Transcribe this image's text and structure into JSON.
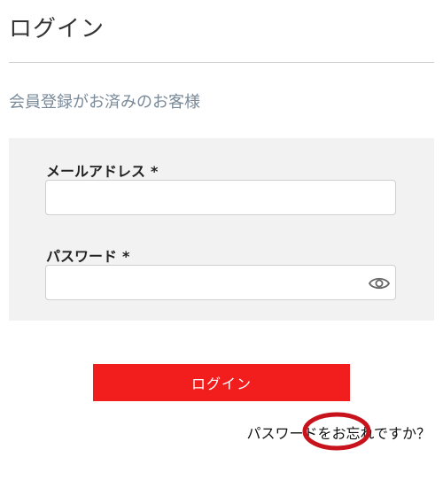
{
  "header": {
    "title": "ログイン"
  },
  "section": {
    "subtitle": "会員登録がお済みのお客様"
  },
  "form": {
    "email": {
      "label": "メールアドレス",
      "required_mark": "*",
      "value": ""
    },
    "password": {
      "label": "パスワード",
      "required_mark": "*",
      "value": "",
      "toggle_icon": "eye-icon"
    }
  },
  "actions": {
    "login_label": "ログイン",
    "forgot_label": "パスワードをお忘れですか？"
  },
  "colors": {
    "accent": "#f21d1d",
    "annotation": "#c8121c",
    "panel": "#f2f2f2",
    "subtitle": "#7a8a99"
  }
}
